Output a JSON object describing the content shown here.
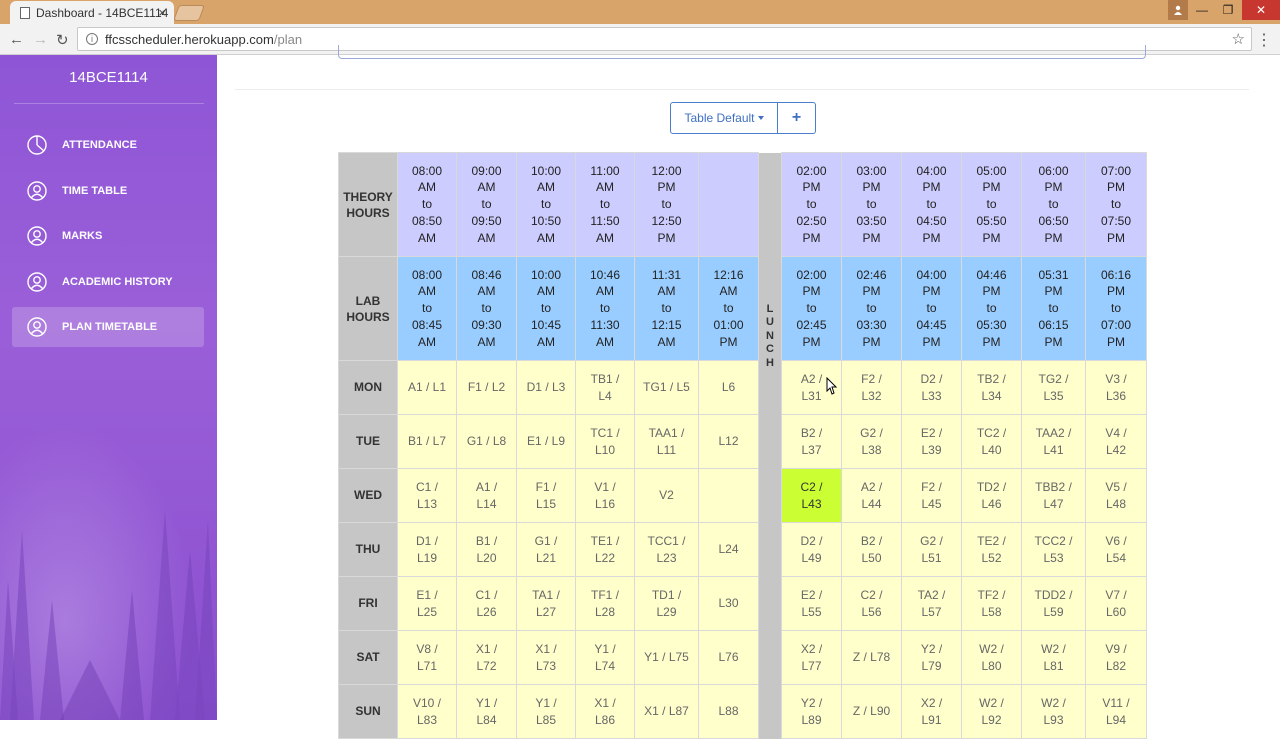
{
  "browser": {
    "tab_title": "Dashboard - 14BCE1114",
    "tab_close": "×",
    "url_host": "ffcsscheduler.herokuapp.com",
    "url_path": "/plan",
    "window_buttons": {
      "minimize": "—",
      "maximize": "❐",
      "close": "✕"
    }
  },
  "sidebar": {
    "brand": "14BCE1114",
    "items": [
      {
        "label": "ATTENDANCE",
        "icon": "pie-chart-icon",
        "active": false
      },
      {
        "label": "TIME TABLE",
        "icon": "user-icon",
        "active": false
      },
      {
        "label": "MARKS",
        "icon": "user-icon",
        "active": false
      },
      {
        "label": "ACADEMIC HISTORY",
        "icon": "user-icon",
        "active": false
      },
      {
        "label": "PLAN TIMETABLE",
        "icon": "user-icon",
        "active": true
      }
    ],
    "accent": "#8e55d6"
  },
  "toolbar": {
    "table_select_label": "Table Default",
    "add_label": "+"
  },
  "timetable": {
    "theory_label": "THEORY HOURS",
    "lab_label": "LAB HOURS",
    "lunch_letters": [
      "L",
      "U",
      "N",
      "C",
      "H"
    ],
    "theory_hours_am": [
      [
        "08:00",
        "AM",
        "to",
        "08:50",
        "AM"
      ],
      [
        "09:00",
        "AM",
        "to",
        "09:50",
        "AM"
      ],
      [
        "10:00",
        "AM",
        "to",
        "10:50",
        "AM"
      ],
      [
        "11:00",
        "AM",
        "to",
        "11:50",
        "AM"
      ],
      [
        "12:00",
        "PM",
        "to",
        "12:50",
        "PM"
      ],
      []
    ],
    "theory_hours_pm": [
      [
        "02:00",
        "PM",
        "to",
        "02:50",
        "PM"
      ],
      [
        "03:00",
        "PM",
        "to",
        "03:50",
        "PM"
      ],
      [
        "04:00",
        "PM",
        "to",
        "04:50",
        "PM"
      ],
      [
        "05:00",
        "PM",
        "to",
        "05:50",
        "PM"
      ],
      [
        "06:00",
        "PM",
        "to",
        "06:50",
        "PM"
      ],
      [
        "07:00",
        "PM",
        "to",
        "07:50",
        "PM"
      ]
    ],
    "lab_hours_am": [
      [
        "08:00",
        "AM",
        "to",
        "08:45",
        "AM"
      ],
      [
        "08:46",
        "AM",
        "to",
        "09:30",
        "AM"
      ],
      [
        "10:00",
        "AM",
        "to",
        "10:45",
        "AM"
      ],
      [
        "10:46",
        "AM",
        "to",
        "11:30",
        "AM"
      ],
      [
        "11:31",
        "AM",
        "to",
        "12:15",
        "AM"
      ],
      [
        "12:16",
        "AM",
        "to",
        "01:00",
        "PM"
      ]
    ],
    "lab_hours_pm": [
      [
        "02:00",
        "PM",
        "to",
        "02:45",
        "PM"
      ],
      [
        "02:46",
        "PM",
        "to",
        "03:30",
        "PM"
      ],
      [
        "04:00",
        "PM",
        "to",
        "04:45",
        "PM"
      ],
      [
        "04:46",
        "PM",
        "to",
        "05:30",
        "PM"
      ],
      [
        "05:31",
        "PM",
        "to",
        "06:15",
        "PM"
      ],
      [
        "06:16",
        "PM",
        "to",
        "07:00",
        "PM"
      ]
    ],
    "days": [
      {
        "day": "MON",
        "am": [
          "A1 / L1",
          "F1 / L2",
          "D1 / L3",
          "TB1 / L4",
          "TG1 / L5",
          "L6"
        ],
        "pm": [
          "A2 / L31",
          "F2 / L32",
          "D2 / L33",
          "TB2 / L34",
          "TG2 / L35",
          "V3 / L36"
        ]
      },
      {
        "day": "TUE",
        "am": [
          "B1 / L7",
          "G1 / L8",
          "E1 / L9",
          "TC1 / L10",
          "TAA1 / L11",
          "L12"
        ],
        "pm": [
          "B2 / L37",
          "G2 / L38",
          "E2 / L39",
          "TC2 / L40",
          "TAA2 / L41",
          "V4 / L42"
        ]
      },
      {
        "day": "WED",
        "am": [
          "C1 / L13",
          "A1 / L14",
          "F1 / L15",
          "V1 / L16",
          "V2",
          ""
        ],
        "pm": [
          "C2 / L43",
          "A2 / L44",
          "F2 / L45",
          "TD2 / L46",
          "TBB2 / L47",
          "V5 / L48"
        ]
      },
      {
        "day": "THU",
        "am": [
          "D1 / L19",
          "B1 / L20",
          "G1 / L21",
          "TE1 / L22",
          "TCC1 / L23",
          "L24"
        ],
        "pm": [
          "D2 / L49",
          "B2 / L50",
          "G2 / L51",
          "TE2 / L52",
          "TCC2 / L53",
          "V6 / L54"
        ]
      },
      {
        "day": "FRI",
        "am": [
          "E1 / L25",
          "C1 / L26",
          "TA1 / L27",
          "TF1 / L28",
          "TD1 / L29",
          "L30"
        ],
        "pm": [
          "E2 / L55",
          "C2 / L56",
          "TA2 / L57",
          "TF2 / L58",
          "TDD2 / L59",
          "V7 / L60"
        ]
      },
      {
        "day": "SAT",
        "am": [
          "V8 / L71",
          "X1 / L72",
          "X1 / L73",
          "Y1 / L74",
          "Y1 / L75",
          "L76"
        ],
        "pm": [
          "X2 / L77",
          "Z / L78",
          "Y2 / L79",
          "W2 / L80",
          "W2 / L81",
          "V9 / L82"
        ]
      },
      {
        "day": "SUN",
        "am": [
          "V10 / L83",
          "Y1 / L84",
          "Y1 / L85",
          "X1 / L86",
          "X1 / L87",
          "L88"
        ],
        "pm": [
          "Y2 / L89",
          "Z / L90",
          "X2 / L91",
          "W2 / L92",
          "W2 / L93",
          "V11 / L94"
        ]
      }
    ],
    "selected_slot": "C2 / L43",
    "colors": {
      "theory": "#ccccff",
      "lab": "#99ccff",
      "cell": "#ffffcc",
      "selected": "#ccff33",
      "header": "#c6c6c6"
    }
  }
}
